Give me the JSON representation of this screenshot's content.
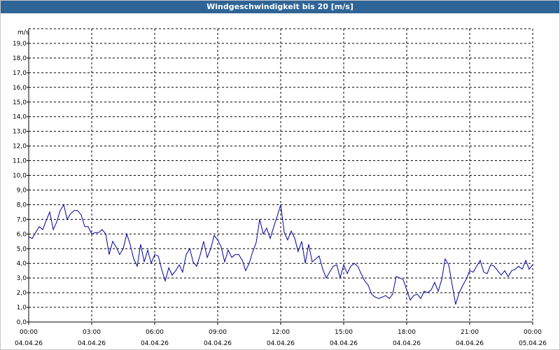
{
  "window": {
    "title": "Windgeschwindigkeit bis 20 [m/s]"
  },
  "chart_data": {
    "type": "line",
    "title": "Windgeschwindigkeit bis 20 [m/s]",
    "ylabel": "m/s",
    "xlabel": "",
    "ylim": [
      0,
      20
    ],
    "xlim_hours": [
      0,
      24
    ],
    "grid": true,
    "legend": "none",
    "colors": {
      "line": "#0000a0",
      "grid": "#000000",
      "axis": "#000000",
      "title_bg": "#2e6496"
    },
    "y_ticks": [
      "0,0",
      "1,0",
      "2,0",
      "3,0",
      "4,0",
      "5,0",
      "6,0",
      "7,0",
      "8,0",
      "9,0",
      "10,0",
      "11,0",
      "12,0",
      "13,0",
      "14,0",
      "15,0",
      "16,0",
      "17,0",
      "18,0",
      "19,0"
    ],
    "x_ticks": [
      {
        "time": "00:00",
        "date": "04.04.26"
      },
      {
        "time": "03:00",
        "date": "04.04.26"
      },
      {
        "time": "06:00",
        "date": "04.04.26"
      },
      {
        "time": "09:00",
        "date": "04.04.26"
      },
      {
        "time": "12:00",
        "date": "04.04.26"
      },
      {
        "time": "15:00",
        "date": "04.04.26"
      },
      {
        "time": "18:00",
        "date": "04.04.26"
      },
      {
        "time": "21:00",
        "date": "04.04.26"
      },
      {
        "time": "00:00",
        "date": "05.04.26"
      }
    ],
    "series": [
      {
        "x_hours": [
          0.0,
          0.17,
          0.33,
          0.5,
          0.67,
          0.83,
          1.0,
          1.17,
          1.33,
          1.5,
          1.67,
          1.83,
          2.0,
          2.17,
          2.33,
          2.5,
          2.67,
          2.83,
          3.0,
          3.17,
          3.33,
          3.5,
          3.67,
          3.83,
          4.0,
          4.17,
          4.33,
          4.5,
          4.67,
          4.83,
          5.0,
          5.17,
          5.33,
          5.5,
          5.67,
          5.83,
          6.0,
          6.17,
          6.33,
          6.5,
          6.67,
          6.83,
          7.0,
          7.17,
          7.33,
          7.5,
          7.67,
          7.83,
          8.0,
          8.17,
          8.33,
          8.5,
          8.67,
          8.83,
          9.0,
          9.17,
          9.33,
          9.5,
          9.67,
          9.83,
          10.0,
          10.17,
          10.33,
          10.5,
          10.67,
          10.83,
          11.0,
          11.17,
          11.33,
          11.5,
          11.67,
          11.83,
          12.0,
          12.17,
          12.33,
          12.5,
          12.67,
          12.83,
          13.0,
          13.17,
          13.33,
          13.5,
          13.67,
          13.83,
          14.0,
          14.17,
          14.33,
          14.5,
          14.67,
          14.83,
          15.0,
          15.17,
          15.33,
          15.5,
          15.67,
          15.83,
          16.0,
          16.17,
          16.33,
          16.5,
          16.67,
          16.83,
          17.0,
          17.17,
          17.33,
          17.5,
          17.67,
          17.83,
          18.0,
          18.17,
          18.33,
          18.5,
          18.67,
          18.83,
          19.0,
          19.17,
          19.33,
          19.5,
          19.67,
          19.83,
          20.0,
          20.17,
          20.33,
          20.5,
          20.67,
          20.83,
          21.0,
          21.17,
          21.33,
          21.5,
          21.67,
          21.83,
          22.0,
          22.17,
          22.33,
          22.5,
          22.67,
          22.83,
          23.0,
          23.17,
          23.33,
          23.5,
          23.67,
          23.83,
          24.0
        ],
        "values": [
          5.8,
          5.7,
          6.1,
          6.5,
          6.3,
          6.9,
          7.5,
          6.3,
          6.8,
          7.6,
          8.0,
          7.0,
          7.4,
          7.6,
          7.6,
          7.3,
          6.5,
          6.5,
          6.0,
          6.1,
          6.1,
          6.3,
          6.0,
          4.6,
          5.5,
          5.1,
          4.6,
          5.0,
          6.0,
          5.3,
          4.3,
          3.8,
          5.3,
          4.1,
          4.9,
          4.0,
          4.6,
          4.5,
          3.6,
          2.8,
          3.7,
          3.2,
          3.5,
          3.9,
          3.4,
          4.6,
          5.0,
          4.1,
          3.8,
          4.6,
          5.5,
          4.4,
          5.0,
          5.9,
          5.6,
          5.1,
          4.1,
          4.9,
          4.4,
          4.6,
          4.6,
          4.2,
          3.5,
          4.0,
          4.8,
          5.4,
          7.0,
          6.0,
          6.4,
          5.7,
          6.5,
          7.2,
          8.0,
          6.1,
          5.6,
          6.2,
          5.7,
          4.8,
          5.5,
          4.0,
          5.3,
          4.1,
          4.3,
          4.5,
          3.6,
          3.0,
          3.4,
          3.8,
          3.9,
          3.0,
          3.9,
          3.3,
          3.8,
          4.0,
          3.8,
          3.3,
          2.8,
          2.5,
          1.9,
          1.7,
          1.6,
          1.7,
          1.8,
          1.6,
          1.9,
          3.1,
          3.0,
          2.9,
          2.2,
          1.5,
          1.8,
          1.9,
          1.6,
          2.1,
          2.0,
          2.2,
          2.7,
          2.1,
          2.9,
          4.3,
          3.9,
          2.5,
          1.2,
          2.0,
          2.5,
          2.9,
          3.5,
          3.4,
          3.8,
          4.2,
          3.4,
          3.3,
          3.9,
          3.8,
          3.5,
          3.2,
          3.5,
          3.1,
          3.5,
          3.6,
          3.8,
          3.6,
          4.2,
          3.6,
          3.9,
          3.9,
          5.1
        ]
      }
    ]
  }
}
